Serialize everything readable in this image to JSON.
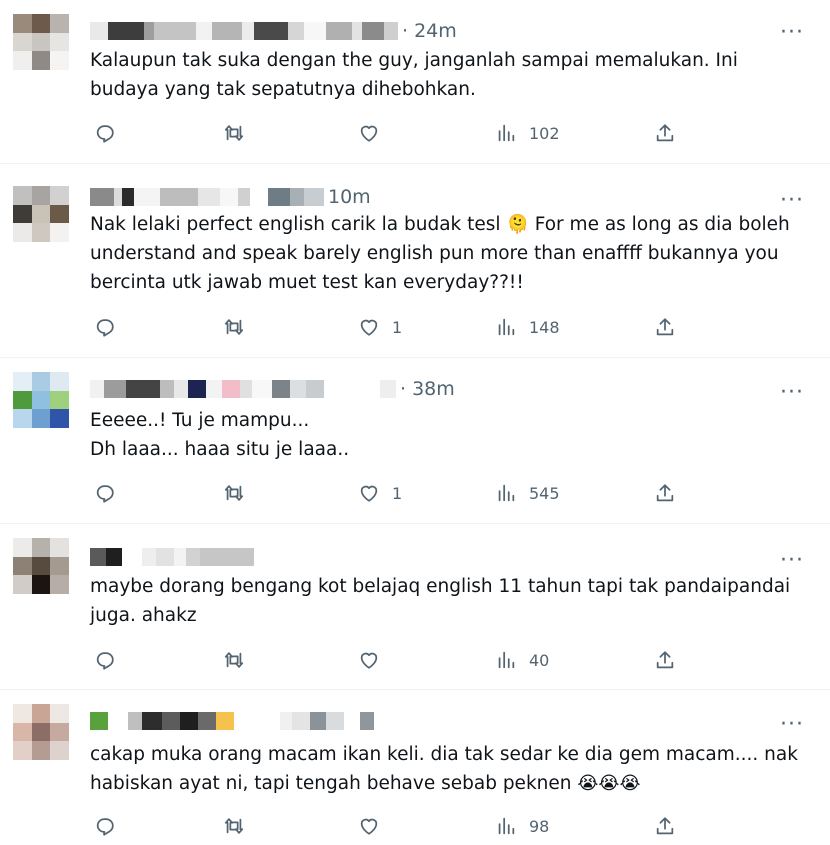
{
  "tweets": [
    {
      "time": "· 24m",
      "text": "Kalaupun tak suka dengan the guy, janganlah sampai memalukan. Ini\nbudaya yang tak sepatutnya dihebohkan.",
      "reply_count": "",
      "retweet_count": "",
      "like_count": "",
      "view_count": "102"
    },
    {
      "time": "10m",
      "text_before_emoji": "Nak lelaki perfect english carik la budak tesl ",
      "emoji": "🫠",
      "text_after_emoji": " For me as long as dia boleh\nunderstand and speak barely english pun more than enaffff bukannya you\nbercinta utk jawab muet test kan everyday??!!",
      "reply_count": "",
      "retweet_count": "",
      "like_count": "1",
      "view_count": "148"
    },
    {
      "time": "· 38m",
      "text": "Eeeee..! Tu je mampu...\nDh laaa... haaa situ je laaa..",
      "reply_count": "",
      "retweet_count": "",
      "like_count": "1",
      "view_count": "545"
    },
    {
      "time": "",
      "text": "maybe dorang bengang kot belajaq english 11 tahun tapi tak pandaipandai\njuga. ahakz",
      "reply_count": "",
      "retweet_count": "",
      "like_count": "",
      "view_count": "40"
    },
    {
      "time": "",
      "text_before_emoji": "cakap muka orang macam ikan keli. dia tak sedar ke dia gem macam.... nak\nhabiskan ayat ni, tapi tengah behave sebab peknen ",
      "emoji": "😭😭😭",
      "text_after_emoji": "",
      "reply_count": "",
      "retweet_count": "",
      "like_count": "",
      "view_count": "98"
    }
  ],
  "icons": {
    "reply": "reply-icon",
    "retweet": "retweet-icon",
    "like": "heart-icon",
    "views": "views-icon",
    "share": "share-icon",
    "more": "more-icon"
  },
  "more_glyph": "···",
  "colors": {
    "text": "#0f1419",
    "secondary": "#536471",
    "divider": "#eff3f4"
  }
}
